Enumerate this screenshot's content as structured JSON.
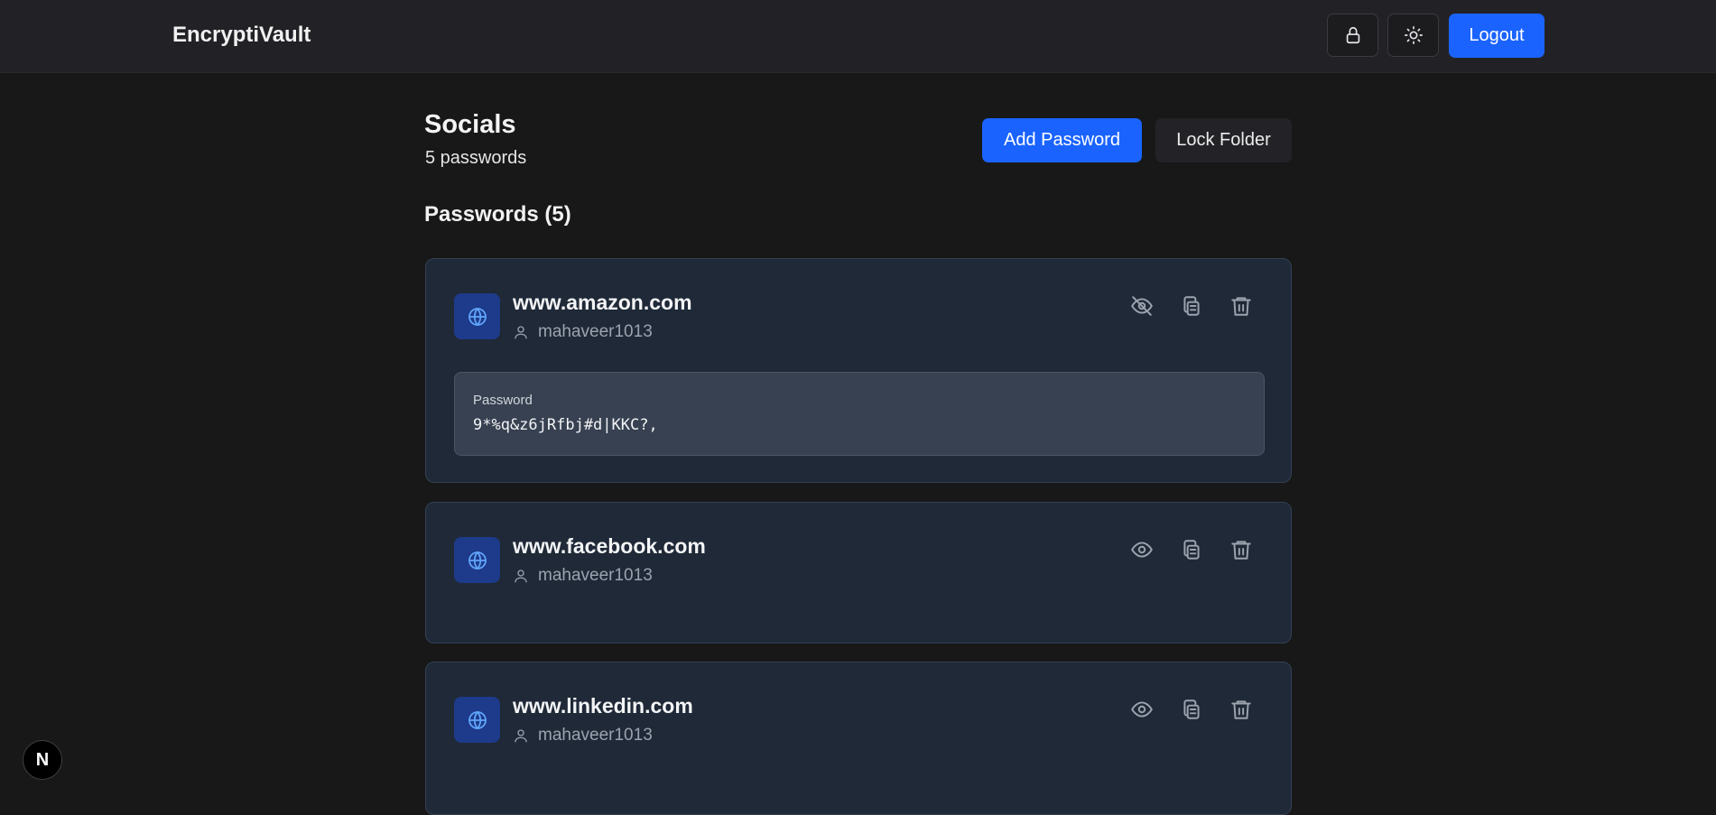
{
  "app": {
    "brand": "EncryptiVault",
    "logout_label": "Logout"
  },
  "folder": {
    "title": "Socials",
    "count_text": "5 passwords",
    "add_label": "Add Password",
    "lock_label": "Lock Folder"
  },
  "section": {
    "title": "Passwords (5)"
  },
  "entries": [
    {
      "site": "www.amazon.com",
      "username": "mahaveer1013",
      "revealed": true,
      "password_label": "Password",
      "password": "9*%q&z6jRfbj#d|KKC?,"
    },
    {
      "site": "www.facebook.com",
      "username": "mahaveer1013",
      "revealed": false
    },
    {
      "site": "www.linkedin.com",
      "username": "mahaveer1013",
      "revealed": false
    }
  ],
  "badge": {
    "letter": "N"
  },
  "colors": {
    "accent": "#1a63ff",
    "card_bg": "#1f2937",
    "page_bg": "#181818"
  }
}
